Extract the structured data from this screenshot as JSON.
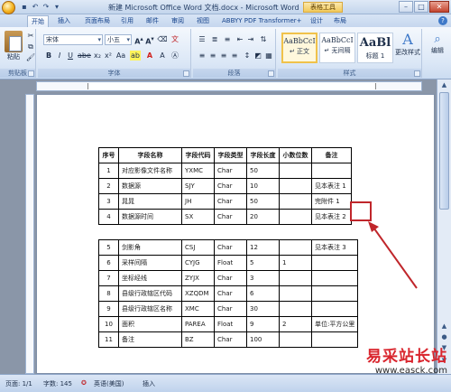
{
  "window": {
    "title": "新建 Microsoft Office Word 文档.docx - Microsoft Word",
    "context_tab": "表格工具"
  },
  "tabs": [
    "开始",
    "插入",
    "页面布局",
    "引用",
    "邮件",
    "审阅",
    "视图",
    "ABBYY PDF Transformer+",
    "设计",
    "布局"
  ],
  "ribbon": {
    "clipboard": {
      "paste_label": "粘贴",
      "group_label": "剪贴板"
    },
    "font": {
      "font_name": "宋体",
      "font_size": "小五",
      "group_label": "字体"
    },
    "paragraph": {
      "group_label": "段落"
    },
    "styles": {
      "group_label": "样式",
      "items": [
        {
          "sample": "AaBbCcI",
          "name": "↵ 正文"
        },
        {
          "sample": "AaBbCcI",
          "name": "↵ 无间隔"
        },
        {
          "sample": "AaBl",
          "name": "标题 1"
        }
      ],
      "change_styles": "更改样式"
    },
    "editing": {
      "label": "编辑"
    }
  },
  "table1": {
    "headers": [
      "序号",
      "字段名称",
      "字段代码",
      "字段类型",
      "字段长度",
      "小数位数",
      "备注"
    ],
    "rows": [
      [
        "1",
        "对应影像文件名称",
        "YXMC",
        "Char",
        "50",
        "",
        ""
      ],
      [
        "2",
        "数据源",
        "SJY",
        "Char",
        "10",
        "",
        "见本表注 1"
      ],
      [
        "3",
        "晁晁",
        "JH",
        "Char",
        "50",
        "",
        "完附件 1"
      ],
      [
        "4",
        "数据源时间",
        "SX",
        "Char",
        "20",
        "",
        "见本表注 2"
      ]
    ]
  },
  "table2": {
    "rows": [
      [
        "5",
        "剑影角",
        "CSJ",
        "Char",
        "12",
        "",
        "见本表注 3"
      ],
      [
        "6",
        "采样间隔",
        "CYJG",
        "Float",
        "5",
        "1",
        ""
      ],
      [
        "7",
        "坐标经线",
        "ZYJX",
        "Char",
        "3",
        "",
        ""
      ],
      [
        "8",
        "县级行政辖区代码",
        "XZQDM",
        "Char",
        "6",
        "",
        ""
      ],
      [
        "9",
        "县级行政辖区名称",
        "XMC",
        "Char",
        "30",
        "",
        ""
      ],
      [
        "10",
        "面积",
        "PAREA",
        "Float",
        "9",
        "2",
        "单位:平方公里"
      ],
      [
        "11",
        "备注",
        "BZ",
        "Char",
        "100",
        "",
        ""
      ]
    ]
  },
  "status": {
    "page": "页面: 1/1",
    "words": "字数: 145",
    "language": "英语(美国)",
    "mode": "插入"
  },
  "watermark": {
    "main": "易采站长站",
    "url": "www.easck.com"
  },
  "colors": {
    "accent": "#15428b",
    "highlight": "#c0262b"
  }
}
